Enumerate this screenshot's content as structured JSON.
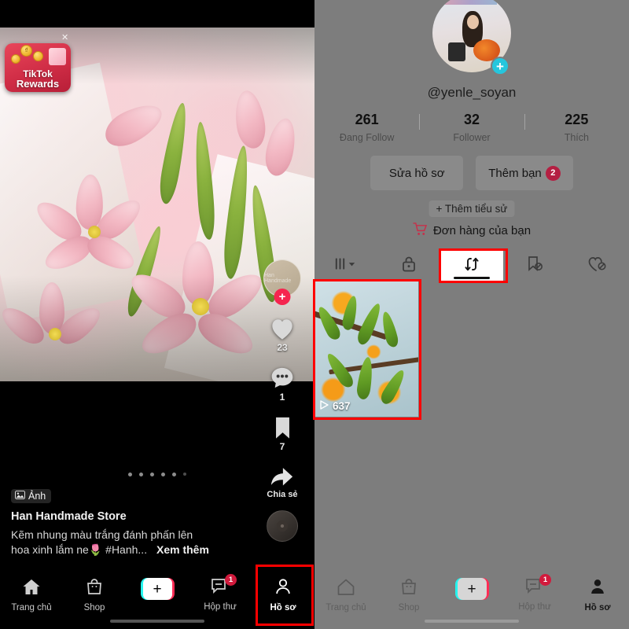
{
  "left_panel": {
    "rewards_badge": {
      "line1": "TikTok",
      "line2": "Rewards",
      "close_icon": "close-icon",
      "coin_label": "₫"
    },
    "action_rail": {
      "avatar_name": "Han Handmade",
      "follow_plus": "+",
      "like": {
        "icon": "heart-icon",
        "count": "23"
      },
      "comment": {
        "icon": "comment-icon",
        "count": "1"
      },
      "bookmark": {
        "icon": "bookmark-icon",
        "count": "7"
      },
      "share": {
        "icon": "share-arrow-icon",
        "label": "Chia sẻ"
      },
      "music_disc": "music-disc-icon"
    },
    "carousel_dots": 6,
    "caption": {
      "photo_pill": "Ảnh",
      "photo_pill_icon": "image-icon",
      "author": "Han Handmade Store",
      "text_line1": "Kẽm nhung màu trắng đánh phấn lên",
      "text_line2": "hoa xinh lắm ne🌷 #Hanh...",
      "more_label": "Xem thêm"
    },
    "bottom_nav": [
      {
        "label": "Trang chủ",
        "icon": "home-icon",
        "active": false
      },
      {
        "label": "Shop",
        "icon": "shop-bag-icon",
        "active": false
      },
      {
        "label": "",
        "icon": "plus-create-icon",
        "active": false
      },
      {
        "label": "Hộp thư",
        "icon": "inbox-icon",
        "badge": "1",
        "active": false
      },
      {
        "label": "Hồ sơ",
        "icon": "profile-person-icon",
        "active": true
      }
    ]
  },
  "right_panel": {
    "profile": {
      "handle": "@yenle_soyan",
      "avatar_add_plus": "+",
      "stats": [
        {
          "value": "261",
          "label": "Đang Follow"
        },
        {
          "value": "32",
          "label": "Follower"
        },
        {
          "value": "225",
          "label": "Thích"
        }
      ],
      "edit_button": "Sửa hồ sơ",
      "add_friend_button": "Thêm bạn",
      "add_friend_badge": "2",
      "add_bio": "+ Thêm tiểu sử",
      "orders": "Đơn hàng của bạn",
      "orders_icon": "cart-icon"
    },
    "tabs": [
      {
        "icon": "grid-playlist-icon",
        "name": "playlist-tab",
        "selected": false
      },
      {
        "icon": "lock-icon",
        "name": "private-tab",
        "selected": false
      },
      {
        "icon": "repost-icon",
        "name": "repost-tab",
        "selected": true
      },
      {
        "icon": "bookmark-off-icon",
        "name": "saved-tab",
        "selected": false
      },
      {
        "icon": "heart-off-icon",
        "name": "liked-tab",
        "selected": false
      }
    ],
    "video": {
      "play_count": "637",
      "play_icon": "play-triangle-icon"
    },
    "bottom_nav": [
      {
        "label": "Trang chủ",
        "icon": "home-icon",
        "active": false
      },
      {
        "label": "Shop",
        "icon": "shop-bag-icon",
        "active": false
      },
      {
        "label": "",
        "icon": "plus-create-icon",
        "active": false
      },
      {
        "label": "Hộp thư",
        "icon": "inbox-icon",
        "badge": "1",
        "active": false
      },
      {
        "label": "Hồ sơ",
        "icon": "profile-person-icon",
        "active": true
      }
    ]
  },
  "highlights": {
    "color": "#fe0000"
  }
}
